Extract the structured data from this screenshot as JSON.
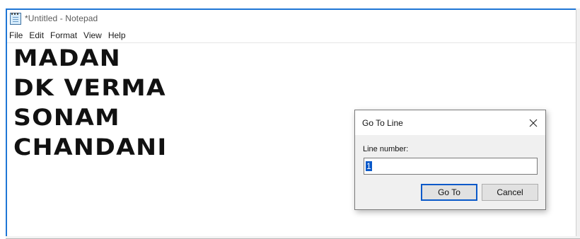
{
  "window": {
    "title": "*Untitled - Notepad",
    "icon": "notepad-icon"
  },
  "menu": {
    "items": [
      "File",
      "Edit",
      "Format",
      "View",
      "Help"
    ]
  },
  "editor": {
    "lines": [
      "MADAN",
      "DK VERMA",
      "SONAM",
      "CHANDANI"
    ]
  },
  "dialog": {
    "title": "Go To Line",
    "close_icon": "close-icon",
    "field_label": "Line number:",
    "field_value": "1",
    "goto_label": "Go To",
    "cancel_label": "Cancel"
  },
  "colors": {
    "window_border": "#1f76d6",
    "selection": "#0a59c9",
    "dialog_bg": "#f0f0f0"
  }
}
